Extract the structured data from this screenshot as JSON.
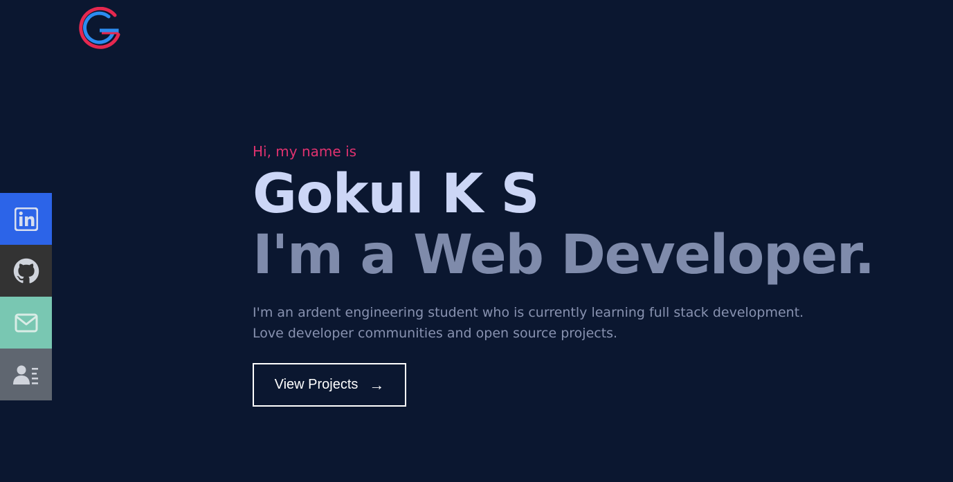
{
  "logo": {
    "icon": "g-logo-icon",
    "colors": [
      "#e5284f",
      "#2c8cf0"
    ]
  },
  "social": [
    {
      "name": "linkedin",
      "icon": "linkedin-icon",
      "bg": "#2c64e8"
    },
    {
      "name": "github",
      "icon": "github-icon",
      "bg": "#333333"
    },
    {
      "name": "email",
      "icon": "mail-icon",
      "bg": "#79c7b2"
    },
    {
      "name": "resume",
      "icon": "contact-card-icon",
      "bg": "#5f6670"
    }
  ],
  "hero": {
    "greeting": "Hi, my name is",
    "name": "Gokul K S",
    "role": "I'm a Web Developer.",
    "bio": "I'm an ardent engineering student who is currently learning full stack development. Love developer communities and open source projects.",
    "cta_label": "View Projects",
    "cta_arrow": "→"
  },
  "colors": {
    "background": "#0b1730",
    "accent": "#e0326f",
    "name": "#ccd6f6",
    "role": "#7f8bab",
    "bio": "#8892b0"
  }
}
